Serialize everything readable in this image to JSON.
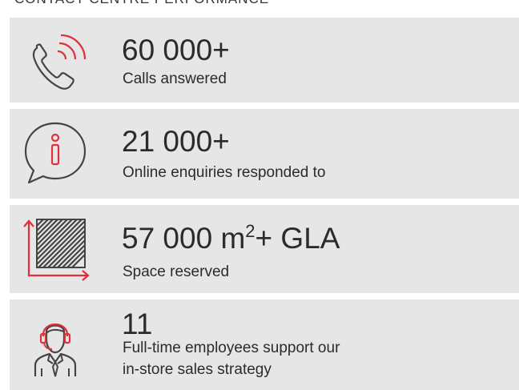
{
  "section": {
    "heading": "CONTACT CENTRE PERFORMANCE"
  },
  "colors": {
    "accent": "#e0303c",
    "row_bg": "#e6e6e6",
    "text": "#2b2b2b",
    "icon_stroke": "#444444"
  },
  "stats": [
    {
      "value": "60 000+",
      "label": "Calls answered",
      "icon": "phone-calling-icon"
    },
    {
      "value": "21 000+",
      "label": "Online enquiries responded to",
      "icon": "info-speech-bubble-icon"
    },
    {
      "value_prefix": "57 000 m",
      "value_sup": "2",
      "value_suffix": "+ GLA",
      "label": "Space reserved",
      "icon": "floor-area-icon"
    },
    {
      "value": "11",
      "label_line1": "Full-time employees support our",
      "label_line2": "in-store sales strategy",
      "icon": "headset-agent-icon"
    }
  ]
}
